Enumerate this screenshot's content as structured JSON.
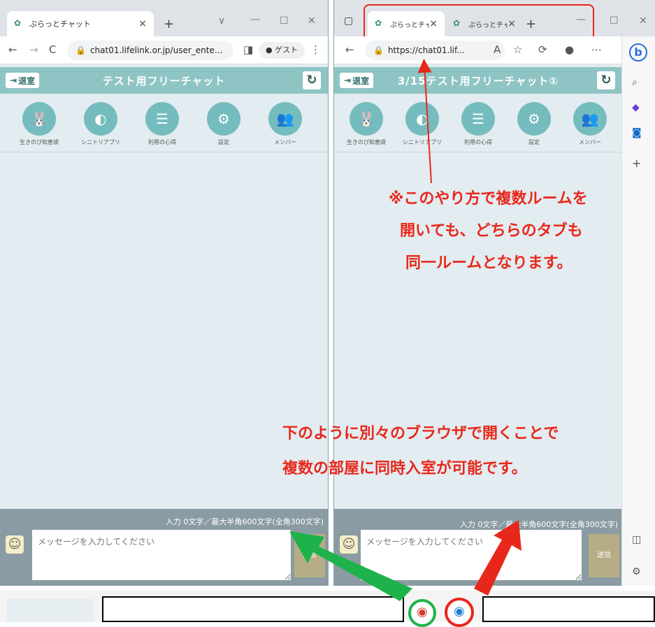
{
  "left_window": {
    "tab_title": "ぷらっとチャット",
    "url": "chat01.lifelink.or.jp/user_ente...",
    "guest_label": "ゲスト",
    "exit_label": "退室",
    "room_title": "テスト用フリーチャット",
    "menu": [
      {
        "label": "生きのび知恵袋",
        "icon": "rabbit-icon"
      },
      {
        "label": "シニトリアプリ",
        "icon": "bird-icon"
      },
      {
        "label": "利用の心得",
        "icon": "list-icon"
      },
      {
        "label": "設定",
        "icon": "gear-icon"
      },
      {
        "label": "メンバー",
        "icon": "members-icon"
      }
    ],
    "counter": "入力 0文字／最大半角600文字(全角300文字)",
    "message_placeholder": "メッセージを入力してください",
    "send_label": "送信"
  },
  "right_window": {
    "tabs": [
      {
        "title": "ぷらっとチャット"
      },
      {
        "title": "ぷらっとチャット"
      }
    ],
    "url": "https://chat01.lif...",
    "exit_label": "退室",
    "room_title": "3/15テスト用フリーチャット①",
    "menu": [
      {
        "label": "生きのび知恵袋",
        "icon": "rabbit-icon"
      },
      {
        "label": "シニトリアプリ",
        "icon": "bird-icon"
      },
      {
        "label": "利用の心得",
        "icon": "list-icon"
      },
      {
        "label": "設定",
        "icon": "gear-icon"
      },
      {
        "label": "メンバー",
        "icon": "members-icon"
      }
    ],
    "counter": "入力 0文字／最大半角600文字(全角300文字)",
    "message_placeholder": "メッセージを入力してください",
    "send_label": "送信"
  },
  "annotations": {
    "note1_line1": "※このやり方で複数ルームを",
    "note1_line2": "開いても、どちらのタブも",
    "note1_line3": "同一ルームとなります。",
    "note2_line1": "下のように別々のブラウザで開くことで",
    "note2_line2": "複数の部屋に同時入室が可能です。"
  },
  "colors": {
    "annotation_red": "#e8271b",
    "arrow_green": "#1db34a",
    "header_teal": "#8fc4c4"
  }
}
